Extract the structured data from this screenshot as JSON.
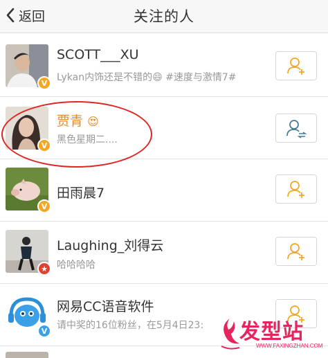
{
  "nav": {
    "back_label": "返回",
    "title": "关注的人"
  },
  "users": [
    {
      "name": "SCOTT___XU",
      "desc": "Lykan内饰还是不错的😄 #速度与激情7#",
      "badge": "V",
      "badge_color": "#f5a623",
      "follow_icon": "add-user-icon",
      "follow_color": "#f5a623"
    },
    {
      "name": "贾青",
      "name_emoji": "😍",
      "desc": "黑色星期二....",
      "badge": "V",
      "badge_color": "#f5a623",
      "follow_icon": "mutual-follow-icon",
      "follow_color": "#4a7a98"
    },
    {
      "name": "田雨晨7",
      "desc": "",
      "badge": "V",
      "badge_color": "#f5a623",
      "follow_icon": "add-user-icon",
      "follow_color": "#f5a623"
    },
    {
      "name": "Laughing_刘得云",
      "desc": "哈哈哈哈",
      "badge": "★",
      "badge_color": "#e0412f",
      "follow_icon": "add-user-icon",
      "follow_color": "#f5a623"
    },
    {
      "name": "网易CC语音软件",
      "desc": "请中奖的16位粉丝，在5月4日23:",
      "badge": "V",
      "badge_color": "#3aa0e8",
      "follow_icon": "add-user-icon",
      "follow_color": "#f5a623"
    }
  ],
  "watermark": {
    "text": "发型站",
    "url": "WWW.FAXINGZHAN.COM"
  },
  "colors": {
    "accent_orange": "#f5a623",
    "highlight_circle": "#e02525",
    "watermark_pink": "#e8245e"
  }
}
